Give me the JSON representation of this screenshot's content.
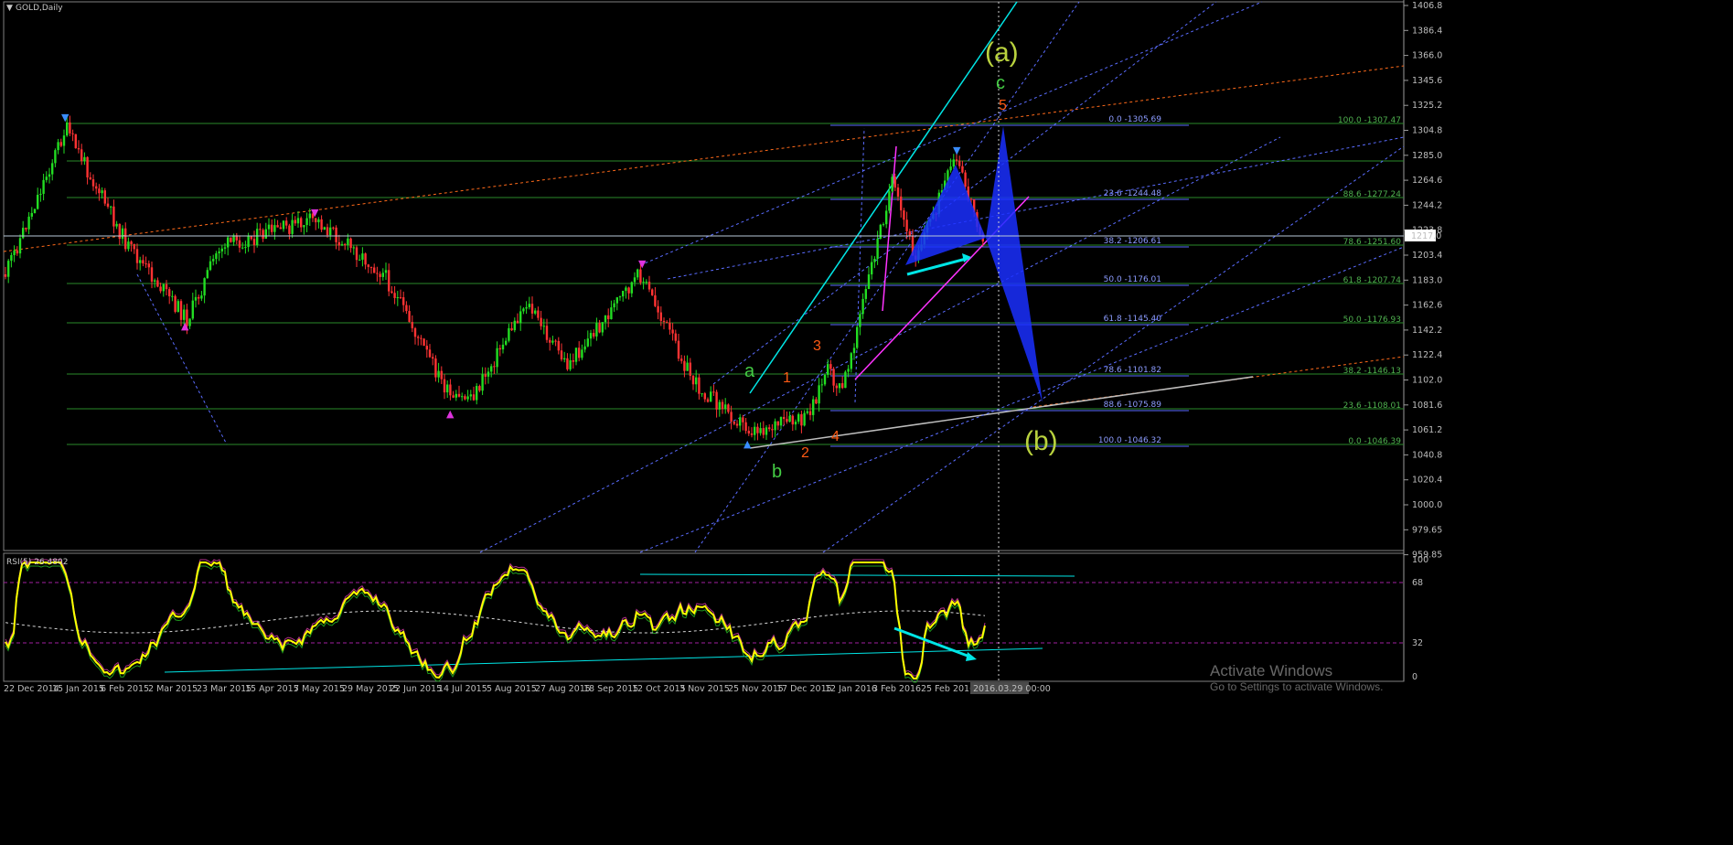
{
  "window": {
    "symbol_title": "GOLD,Daily",
    "indicator_title": "RSI(5) 26.4802"
  },
  "colors": {
    "background": "#000000",
    "bull_candle": "#22dd22",
    "bear_candle": "#ff3333",
    "fib_green": "#2a8a2a",
    "fib_blue": "#5a6cff",
    "trend_cyan": "#00e6e6",
    "trend_magenta": "#ff33ff",
    "trend_orange": "#ff6a1a",
    "pattern_blue": "#1a2fff",
    "rsi_line": "#ffff00",
    "wave_green": "#44cc44",
    "wave_orange": "#ff5a14",
    "wave_yellowgreen": "#b9d23e"
  },
  "price_axis": {
    "ticks": [
      "1406.8",
      "1386.4",
      "1366.0",
      "1345.6",
      "1325.2",
      "1304.8",
      "1285.0",
      "1264.6",
      "1244.2",
      "1223.8",
      "1203.4",
      "1183.0",
      "1162.6",
      "1142.2",
      "1122.4",
      "1102.0",
      "1081.6",
      "1061.2",
      "1040.8",
      "1020.4",
      "1000.0",
      "979.65",
      "959.85"
    ],
    "current_price": "1217.0"
  },
  "rsi_axis": {
    "ticks": [
      "100",
      "68",
      "32",
      "0"
    ]
  },
  "time_axis": {
    "labels": [
      "22 Dec 2014",
      "15 Jan 2015",
      "6 Feb 2015",
      "2 Mar 2015",
      "23 Mar 2015",
      "15 Apr 2015",
      "7 May 2015",
      "29 May 2015",
      "22 Jun 2015",
      "14 Jul 2015",
      "5 Aug 2015",
      "27 Aug 2015",
      "18 Sep 2015",
      "12 Oct 2015",
      "3 Nov 2015",
      "25 Nov 2015",
      "17 Dec 2015",
      "12 Jan 2016",
      "3 Feb 2016",
      "25 Feb 2016"
    ],
    "cursor_date": "2016.03.29 00:00"
  },
  "fib_labels_left": [
    "0.0 -1305.69",
    "23.6 -1244.48",
    "38.2 -1206.61",
    "50.0 -1176.01",
    "61.8 -1145.40",
    "78.6 -1101.82",
    "88.6 -1075.89",
    "100.0 -1046.32"
  ],
  "fib_labels_right": [
    "100.0 -1307.47",
    "88.6 -1277.24",
    "78.6 -1251.60",
    "61.8 -1207.74",
    "50.0 -1176.93",
    "38.2 -1146.13",
    "23.6 -1108.01",
    "0.0 -1046.39"
  ],
  "wave_labels": {
    "a": "a",
    "b": "b",
    "c": "c",
    "w1": "1",
    "w2": "2",
    "w3": "3",
    "w4": "4",
    "w5": "5",
    "big_a": "(a)",
    "big_b": "(b)"
  },
  "watermark": {
    "title": "Activate Windows",
    "subtitle": "Go to Settings to activate Windows."
  }
}
